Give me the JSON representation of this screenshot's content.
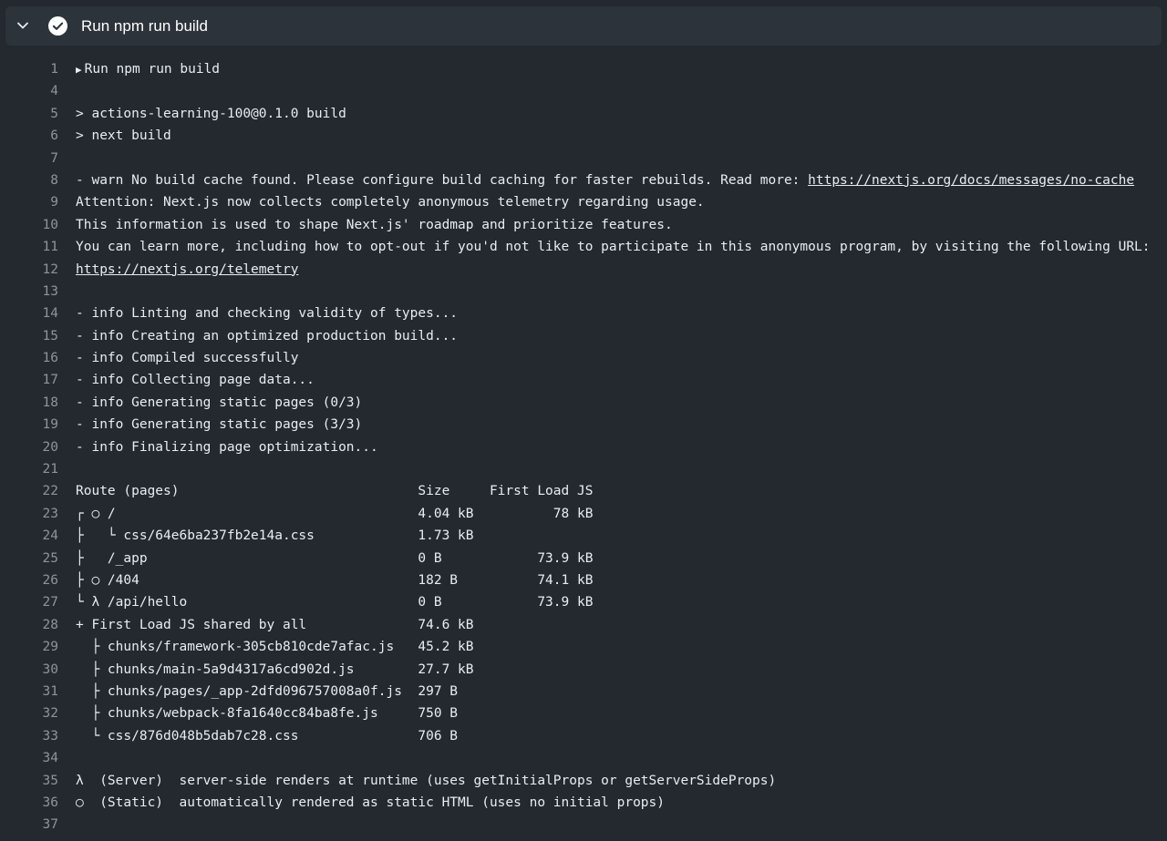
{
  "step": {
    "title": "Run npm run build",
    "status": "success"
  },
  "icons": {
    "collapse": "chevron-down-icon",
    "status": "check-circle-icon",
    "group": "triangle-right-icon"
  },
  "colors": {
    "background": "#24292f",
    "header": "#2d333b",
    "text": "#e6edf3",
    "line_number": "#8b949e"
  },
  "lines": [
    {
      "n": "1",
      "t": "Run npm run build",
      "group": true
    },
    {
      "n": "4",
      "t": ""
    },
    {
      "n": "5",
      "t": "> actions-learning-100@0.1.0 build"
    },
    {
      "n": "6",
      "t": "> next build"
    },
    {
      "n": "7",
      "t": ""
    },
    {
      "n": "8",
      "t": "- warn No build cache found. Please configure build caching for faster rebuilds. Read more: ",
      "link": "https://nextjs.org/docs/messages/no-cache"
    },
    {
      "n": "9",
      "t": "Attention: Next.js now collects completely anonymous telemetry regarding usage."
    },
    {
      "n": "10",
      "t": "This information is used to shape Next.js' roadmap and prioritize features."
    },
    {
      "n": "11",
      "t": "You can learn more, including how to opt-out if you'd not like to participate in this anonymous program, by visiting the following URL:"
    },
    {
      "n": "12",
      "t": "",
      "link": "https://nextjs.org/telemetry"
    },
    {
      "n": "13",
      "t": ""
    },
    {
      "n": "14",
      "t": "- info Linting and checking validity of types..."
    },
    {
      "n": "15",
      "t": "- info Creating an optimized production build..."
    },
    {
      "n": "16",
      "t": "- info Compiled successfully"
    },
    {
      "n": "17",
      "t": "- info Collecting page data..."
    },
    {
      "n": "18",
      "t": "- info Generating static pages (0/3)"
    },
    {
      "n": "19",
      "t": "- info Generating static pages (3/3)"
    },
    {
      "n": "20",
      "t": "- info Finalizing page optimization..."
    },
    {
      "n": "21",
      "t": ""
    },
    {
      "n": "22",
      "t": "Route (pages)                              Size     First Load JS"
    },
    {
      "n": "23",
      "t": "┌ ○ /                                      4.04 kB          78 kB"
    },
    {
      "n": "24",
      "t": "├   └ css/64e6ba237fb2e14a.css             1.73 kB"
    },
    {
      "n": "25",
      "t": "├   /_app                                  0 B            73.9 kB"
    },
    {
      "n": "26",
      "t": "├ ○ /404                                   182 B          74.1 kB"
    },
    {
      "n": "27",
      "t": "└ λ /api/hello                             0 B            73.9 kB"
    },
    {
      "n": "28",
      "t": "+ First Load JS shared by all              74.6 kB"
    },
    {
      "n": "29",
      "t": "  ├ chunks/framework-305cb810cde7afac.js   45.2 kB"
    },
    {
      "n": "30",
      "t": "  ├ chunks/main-5a9d4317a6cd902d.js        27.7 kB"
    },
    {
      "n": "31",
      "t": "  ├ chunks/pages/_app-2dfd096757008a0f.js  297 B"
    },
    {
      "n": "32",
      "t": "  ├ chunks/webpack-8fa1640cc84ba8fe.js     750 B"
    },
    {
      "n": "33",
      "t": "  └ css/876d048b5dab7c28.css               706 B"
    },
    {
      "n": "34",
      "t": ""
    },
    {
      "n": "35",
      "t": "λ  (Server)  server-side renders at runtime (uses getInitialProps or getServerSideProps)"
    },
    {
      "n": "36",
      "t": "○  (Static)  automatically rendered as static HTML (uses no initial props)"
    },
    {
      "n": "37",
      "t": ""
    }
  ]
}
